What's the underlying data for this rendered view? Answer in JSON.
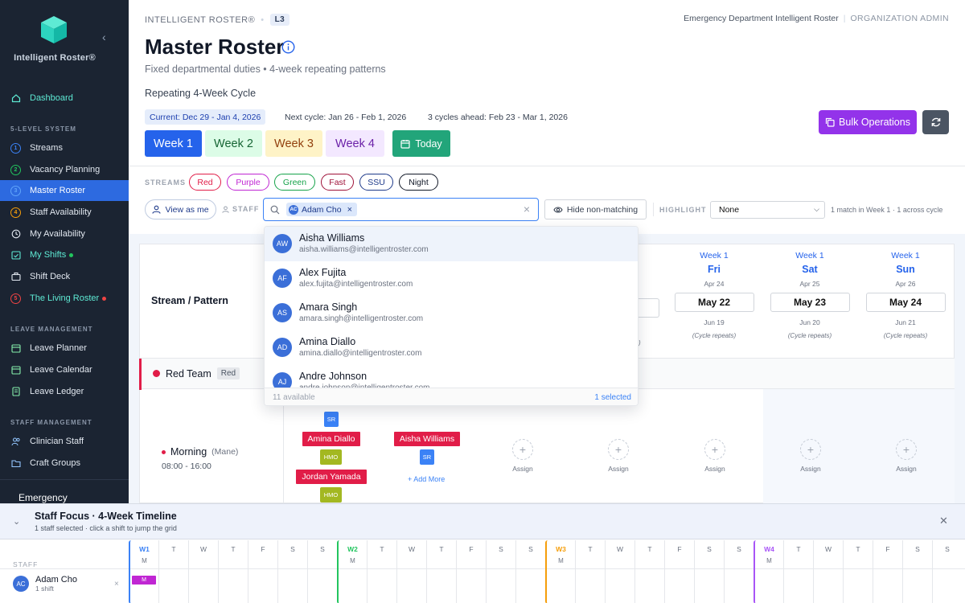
{
  "sidebar": {
    "brand": "Intelligent Roster®",
    "nav": [
      {
        "label": "Dashboard",
        "icon": "dashboard-icon",
        "teal": true
      },
      {
        "label": "Streams",
        "num": "1",
        "numColor": "#3b82f6"
      },
      {
        "label": "Vacancy Planning",
        "num": "2",
        "numColor": "#22c55e"
      },
      {
        "label": "Master Roster",
        "num": "3",
        "numColor": "#60a5fa",
        "active": true
      },
      {
        "label": "Staff Availability",
        "num": "4",
        "numColor": "#f59e0b"
      },
      {
        "label": "My Availability",
        "icon": "clock-icon"
      },
      {
        "label": "My Shifts",
        "icon": "calendar-check-icon",
        "teal": true,
        "dot": "#22c55e"
      },
      {
        "label": "Shift Deck",
        "icon": "briefcase-icon"
      },
      {
        "label": "The Living Roster",
        "num": "5",
        "numColor": "#ef4444",
        "teal": true,
        "dot": "#ef4444"
      },
      {
        "label": "Leave Planner",
        "icon": "calendar-icon"
      },
      {
        "label": "Leave Calendar",
        "icon": "calendar-icon"
      },
      {
        "label": "Leave Ledger",
        "icon": "ledger-icon"
      },
      {
        "label": "Clinician Staff",
        "icon": "users-icon"
      },
      {
        "label": "Craft Groups",
        "icon": "folder-icon"
      }
    ],
    "sections": [
      "5-LEVEL SYSTEM",
      "LEAVE MANAGEMENT",
      "STAFF MANAGEMENT"
    ],
    "footer": "Emergency"
  },
  "header": {
    "crumb": "INTELLIGENT ROSTER®",
    "level": "L3",
    "org": "Emergency Department Intelligent Roster",
    "role": "ORGANIZATION ADMIN",
    "title": "Master Roster",
    "subtitle": "Fixed departmental duties • 4-week repeating patterns",
    "cycle_label": "Repeating 4-Week Cycle",
    "current": "Current: Dec 29 - Jan 4, 2026",
    "next": "Next cycle: Jan 26 - Feb 1, 2026",
    "ahead": "3 cycles ahead: Feb 23 - Mar 1, 2026",
    "weeks": [
      "Week 1",
      "Week 2",
      "Week 3",
      "Week 4"
    ],
    "today": "Today",
    "bulk": "Bulk Operations"
  },
  "filters": {
    "streams_label": "STREAMS",
    "streams": [
      {
        "label": "Red",
        "color": "#e11d48"
      },
      {
        "label": "Purple",
        "color": "#c026d3"
      },
      {
        "label": "Green",
        "color": "#16a34a"
      },
      {
        "label": "Fast",
        "color": "#9f1239"
      },
      {
        "label": "SSU",
        "color": "#1e3a8a"
      },
      {
        "label": "Night",
        "color": "#111827"
      }
    ],
    "view_as_me": "View as me",
    "staff_label": "STAFF",
    "token": "Adam Cho",
    "token_initials": "AC",
    "hide": "Hide non-matching",
    "highlight_label": "HIGHLIGHT",
    "highlight_value": "None",
    "match": "1 match in Week 1 · 1 across cycle"
  },
  "grid": {
    "stream_pattern": "Stream / Pattern",
    "days": [
      {
        "week": "Week 1",
        "day": "Fri",
        "date": "Apr 24",
        "box": "May 22",
        "jun": "Jun 19",
        "repeat": "(Cycle repeats)"
      },
      {
        "week": "Week 1",
        "day": "Sat",
        "date": "Apr 25",
        "box": "May 23",
        "jun": "Jun 20",
        "repeat": "(Cycle repeats)"
      },
      {
        "week": "Week 1",
        "day": "Sun",
        "date": "Apr 26",
        "box": "May 24",
        "jun": "Jun 21",
        "repeat": "(Cycle repeats)"
      }
    ],
    "partial_repeat": "s)",
    "team": "Red Team",
    "team_tag": "Red",
    "shift": "Morning",
    "shift_manager": "(Mane)",
    "shift_time": "08:00 - 16:00",
    "assign": "Assign",
    "add_more": "+ Add More",
    "assignments": [
      {
        "name": "Amina Diallo",
        "badge": "HMO",
        "badgeColor": "#a3b821"
      },
      {
        "name": "Jordan Yamada",
        "badge": "HMO",
        "badgeColor": "#a3b821"
      },
      {
        "name": "Aisha Williams",
        "badge": "SR",
        "badgeColor": "#3b82f6"
      }
    ],
    "top_badge": "SR"
  },
  "dropdown": {
    "items": [
      {
        "initials": "AW",
        "name": "Aisha Williams",
        "email": "aisha.williams@intelligentroster.com"
      },
      {
        "initials": "AF",
        "name": "Alex Fujita",
        "email": "alex.fujita@intelligentroster.com"
      },
      {
        "initials": "AS",
        "name": "Amara Singh",
        "email": "amara.singh@intelligentroster.com"
      },
      {
        "initials": "AD",
        "name": "Amina Diallo",
        "email": "amina.diallo@intelligentroster.com"
      },
      {
        "initials": "AJ",
        "name": "Andre Johnson",
        "email": "andre.johnson@intelligentroster.com"
      }
    ],
    "available": "11 available",
    "selected": "1 selected"
  },
  "bottom": {
    "title": "Staff Focus · 4-Week Timeline",
    "subtitle": "1 staff selected · click a shift to jump the grid",
    "staff_label": "STAFF",
    "user_initials": "AC",
    "user_name": "Adam Cho",
    "user_count": "1 shift",
    "shift_code": "M",
    "days": [
      {
        "l": "W1",
        "m": "M",
        "wk": "#3b82f6"
      },
      {
        "l": "T"
      },
      {
        "l": "W"
      },
      {
        "l": "T"
      },
      {
        "l": "F"
      },
      {
        "l": "S"
      },
      {
        "l": "S"
      },
      {
        "l": "W2",
        "m": "M",
        "wk": "#22c55e"
      },
      {
        "l": "T"
      },
      {
        "l": "W"
      },
      {
        "l": "T"
      },
      {
        "l": "F"
      },
      {
        "l": "S"
      },
      {
        "l": "S"
      },
      {
        "l": "W3",
        "m": "M",
        "wk": "#f59e0b"
      },
      {
        "l": "T"
      },
      {
        "l": "W"
      },
      {
        "l": "T"
      },
      {
        "l": "F"
      },
      {
        "l": "S"
      },
      {
        "l": "S"
      },
      {
        "l": "W4",
        "m": "M",
        "wk": "#a855f7"
      },
      {
        "l": "T"
      },
      {
        "l": "W"
      },
      {
        "l": "T"
      },
      {
        "l": "F"
      },
      {
        "l": "S"
      },
      {
        "l": "S"
      }
    ]
  }
}
